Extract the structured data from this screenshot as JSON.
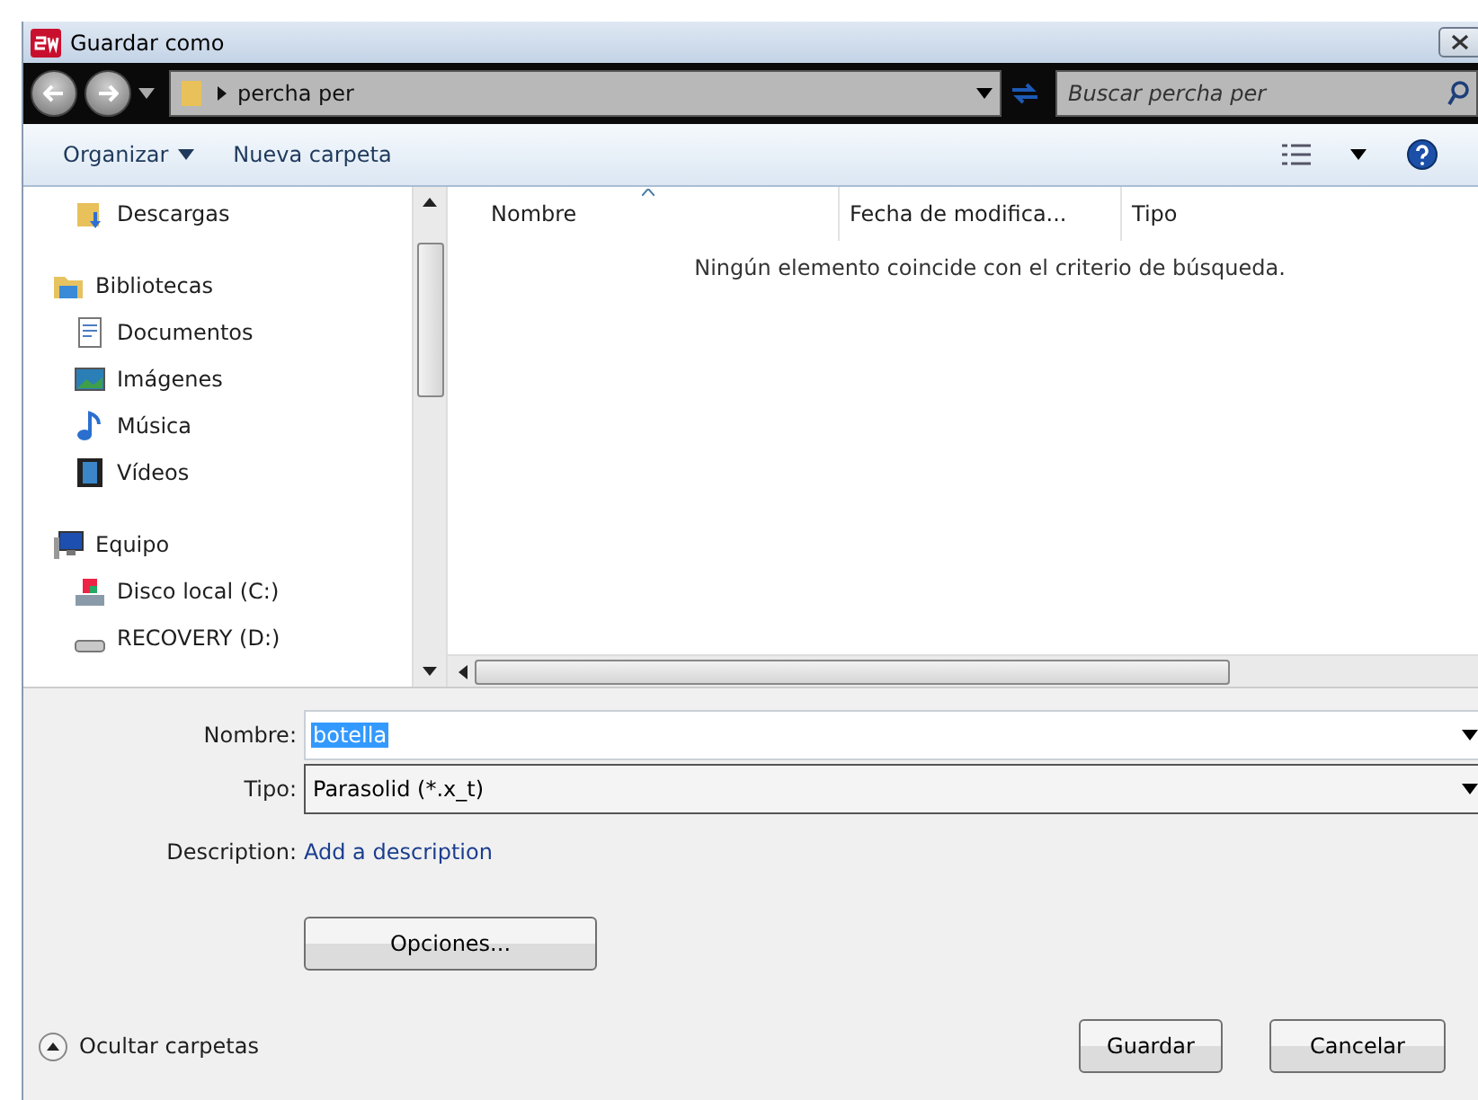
{
  "window": {
    "title": "Guardar como"
  },
  "address": {
    "path": "percha per"
  },
  "search": {
    "placeholder": "Buscar percha per"
  },
  "toolbar": {
    "organize": "Organizar",
    "new_folder": "Nueva carpeta"
  },
  "nav": [
    {
      "label": "Descargas",
      "kind": "downloads"
    },
    {
      "label": "Bibliotecas",
      "kind": "library",
      "children": [
        {
          "label": "Documentos",
          "kind": "documents"
        },
        {
          "label": "Imágenes",
          "kind": "pictures"
        },
        {
          "label": "Música",
          "kind": "music"
        },
        {
          "label": "Vídeos",
          "kind": "videos"
        }
      ]
    },
    {
      "label": "Equipo",
      "kind": "computer",
      "children": [
        {
          "label": "Disco local (C:)",
          "kind": "disk"
        },
        {
          "label": "RECOVERY (D:)",
          "kind": "drive"
        }
      ]
    }
  ],
  "columns": [
    {
      "label": "Nombre",
      "sorted": true
    },
    {
      "label": "Fecha de modifica...",
      "sorted": false
    },
    {
      "label": "Tipo",
      "sorted": false
    }
  ],
  "empty_message": "Ningún elemento coincide con el criterio de búsqueda.",
  "form": {
    "name_label": "Nombre:",
    "name_value": "botella",
    "name_highlighted": true,
    "type_label": "Tipo:",
    "type_value": "Parasolid (*.x_t)",
    "description_label": "Description:",
    "description_link": "Add a description"
  },
  "options_button": "Opciones...",
  "hide_folders": "Ocultar carpetas",
  "buttons": [
    "Guardar",
    "Cancelar"
  ]
}
